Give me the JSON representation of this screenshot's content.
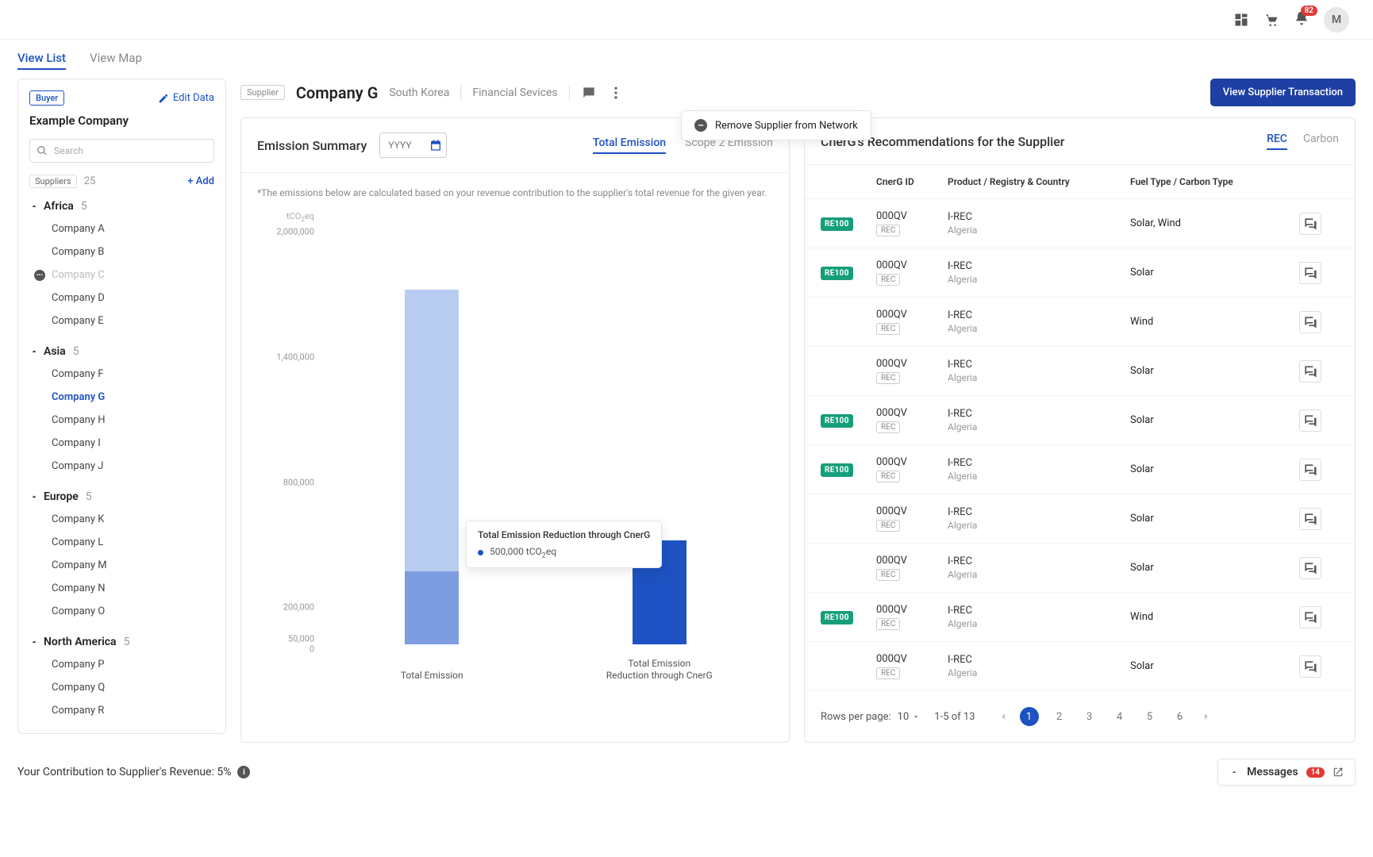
{
  "topbar": {
    "notification_count": "82",
    "avatar_initial": "M"
  },
  "view_tabs": {
    "list": "View List",
    "map": "View Map"
  },
  "sidebar": {
    "buyer_tag": "Buyer",
    "edit_data": "Edit Data",
    "company": "Example Company",
    "search_placeholder": "Search",
    "suppliers_label": "Suppliers",
    "suppliers_count": "25",
    "add_label": "+ Add",
    "regions": [
      {
        "name": "Africa",
        "count": "5",
        "companies": [
          "Company A",
          "Company B",
          "Company C",
          "Company D",
          "Company E"
        ],
        "muted_index": 2
      },
      {
        "name": "Asia",
        "count": "5",
        "companies": [
          "Company F",
          "Company G",
          "Company H",
          "Company I",
          "Company J"
        ],
        "active_index": 1
      },
      {
        "name": "Europe",
        "count": "5",
        "companies": [
          "Company K",
          "Company L",
          "Company M",
          "Company N",
          "Company O"
        ]
      },
      {
        "name": "North America",
        "count": "5",
        "companies": [
          "Company P",
          "Company Q",
          "Company R"
        ]
      }
    ]
  },
  "header": {
    "supplier_tag": "Supplier",
    "name": "Company G",
    "country": "South Korea",
    "sector": "Financial Sevices",
    "view_transaction_btn": "View Supplier Transaction",
    "remove_supplier": "Remove Supplier from Network"
  },
  "emission": {
    "title": "Emission Summary",
    "year_placeholder": "YYYY",
    "tabs": {
      "total": "Total Emission",
      "scope2": "Scope 2 Emission"
    },
    "note": "*The emissions below are calculated based on your revenue contribution to the supplier's total revenue for the given year.",
    "tooltip_title": "Total Emission Reduction through CnerG",
    "tooltip_value": "500,000 tCO₂eq"
  },
  "chart_data": {
    "type": "bar",
    "y_unit": "tCO₂eq",
    "categories": [
      "Total Emission",
      "Total Emission\nReduction through CnerG"
    ],
    "series": [
      {
        "name": "lower",
        "values": [
          350000,
          0
        ],
        "color": "#7d9de0"
      },
      {
        "name": "upper",
        "values": [
          1350000,
          0
        ],
        "color": "#b9cdf1"
      },
      {
        "name": "single",
        "values": [
          0,
          500000
        ],
        "color": "#1e52c2"
      }
    ],
    "y_ticks": [
      0,
      50000,
      200000,
      800000,
      1400000,
      2000000
    ],
    "y_tick_labels": [
      "0",
      "50,000",
      "200,000",
      "800,000",
      "1,400,000",
      "2,000,000"
    ],
    "ylim": [
      0,
      2000000
    ]
  },
  "reco": {
    "title": "CnerG's Recommendations for the Supplier",
    "tabs": {
      "rec": "REC",
      "carbon": "Carbon"
    },
    "columns": {
      "id": "CnerG ID",
      "product": "Product / Registry & Country",
      "fuel": "Fuel Type / Carbon Type"
    },
    "rows": [
      {
        "re100": true,
        "id": "000QV",
        "rec": "REC",
        "product": "I-REC",
        "country": "Algeria",
        "fuel": "Solar, Wind"
      },
      {
        "re100": true,
        "id": "000QV",
        "rec": "REC",
        "product": "I-REC",
        "country": "Algeria",
        "fuel": "Solar"
      },
      {
        "re100": false,
        "id": "000QV",
        "rec": "REC",
        "product": "I-REC",
        "country": "Algeria",
        "fuel": "Wind"
      },
      {
        "re100": false,
        "id": "000QV",
        "rec": "REC",
        "product": "I-REC",
        "country": "Algeria",
        "fuel": "Solar"
      },
      {
        "re100": true,
        "id": "000QV",
        "rec": "REC",
        "product": "I-REC",
        "country": "Algeria",
        "fuel": "Solar"
      },
      {
        "re100": true,
        "id": "000QV",
        "rec": "REC",
        "product": "I-REC",
        "country": "Algeria",
        "fuel": "Solar"
      },
      {
        "re100": false,
        "id": "000QV",
        "rec": "REC",
        "product": "I-REC",
        "country": "Algeria",
        "fuel": "Solar"
      },
      {
        "re100": false,
        "id": "000QV",
        "rec": "REC",
        "product": "I-REC",
        "country": "Algeria",
        "fuel": "Solar"
      },
      {
        "re100": true,
        "id": "000QV",
        "rec": "REC",
        "product": "I-REC",
        "country": "Algeria",
        "fuel": "Wind"
      },
      {
        "re100": false,
        "id": "000QV",
        "rec": "REC",
        "product": "I-REC",
        "country": "Algeria",
        "fuel": "Solar"
      }
    ],
    "pager": {
      "rpp_label": "Rows per page:",
      "rpp_value": "10",
      "range": "1-5 of 13",
      "pages": [
        "1",
        "2",
        "3",
        "4",
        "5",
        "6"
      ],
      "active": "1"
    }
  },
  "footer": {
    "contribution": "Your Contribution to Supplier's Revenue: 5%",
    "messages_label": "Messages",
    "messages_count": "14"
  }
}
